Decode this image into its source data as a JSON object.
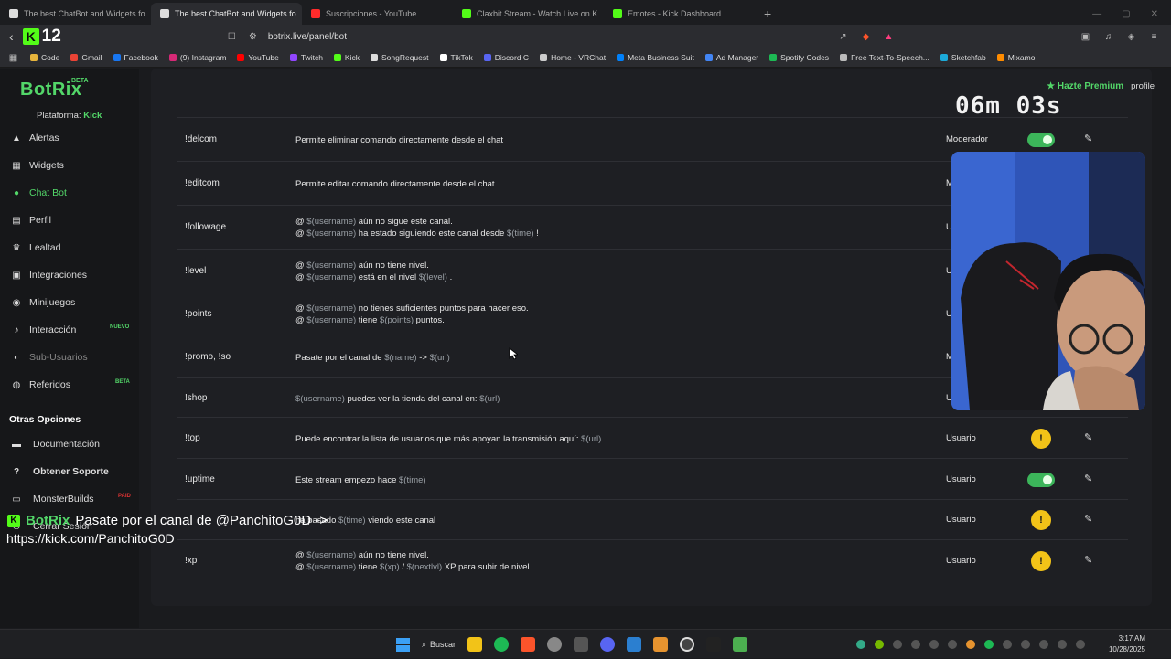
{
  "tabs": [
    {
      "title": "The best ChatBot and Widgets fo",
      "color": "#dddddd",
      "active": false
    },
    {
      "title": "The best ChatBot and Widgets fo",
      "color": "#dddddd",
      "active": true
    },
    {
      "title": "Suscripciones - YouTube",
      "color": "#ff2b2b",
      "active": false
    },
    {
      "title": "Claxbit Stream - Watch Live on K",
      "color": "#53fc18",
      "active": false
    },
    {
      "title": "Emotes - Kick Dashboard",
      "color": "#53fc18",
      "active": false
    }
  ],
  "address": {
    "url": "botrix.live/panel/bot",
    "overlay_number": "12"
  },
  "bookmarks": [
    {
      "label": "Code",
      "color": "#e7b43c"
    },
    {
      "label": "Gmail",
      "color": "#ea4335"
    },
    {
      "label": "Facebook",
      "color": "#1877f2"
    },
    {
      "label": "(9) Instagram",
      "color": "#d62976"
    },
    {
      "label": "YouTube",
      "color": "#ff0000"
    },
    {
      "label": "Twitch",
      "color": "#9146ff"
    },
    {
      "label": "Kick",
      "color": "#53fc18"
    },
    {
      "label": "SongRequest",
      "color": "#dddddd"
    },
    {
      "label": "TikTok",
      "color": "#ffffff"
    },
    {
      "label": "Discord C",
      "color": "#5865f2"
    },
    {
      "label": "Home - VRChat",
      "color": "#cccccc"
    },
    {
      "label": "Meta Business Suit",
      "color": "#0081fb"
    },
    {
      "label": "Ad Manager",
      "color": "#4285f4"
    },
    {
      "label": "Spotify Codes",
      "color": "#1db954"
    },
    {
      "label": "Free Text-To-Speech...",
      "color": "#bbbbbb"
    },
    {
      "label": "Sketchfab",
      "color": "#1caad9"
    },
    {
      "label": "Mixamo",
      "color": "#ff8c00"
    }
  ],
  "sidebar": {
    "brand": "BotRix",
    "brand_badge": "BETA",
    "platform_label": "Plataforma:",
    "platform_value": "Kick",
    "items": [
      {
        "label": "Alertas",
        "icon": "▲"
      },
      {
        "label": "Widgets",
        "icon": "▦"
      },
      {
        "label": "Chat Bot",
        "icon": "●"
      },
      {
        "label": "Perfil",
        "icon": "▤"
      },
      {
        "label": "Lealtad",
        "icon": "♛"
      },
      {
        "label": "Integraciones",
        "icon": "▣"
      },
      {
        "label": "Minijuegos",
        "icon": "◉"
      },
      {
        "label": "Interacción",
        "icon": "♪"
      },
      {
        "label": "Sub-Usuarios",
        "icon": "◐"
      },
      {
        "label": "Referidos",
        "icon": "◍"
      }
    ],
    "badge_nuevo": "NUEVO",
    "badge_beta": "BETA",
    "section_other": "Otras Opciones",
    "other": [
      {
        "label": "Documentación",
        "icon": "▬"
      },
      {
        "label": "Obtener Soporte",
        "icon": "?"
      },
      {
        "label": "MonsterBuilds",
        "icon": "▭"
      },
      {
        "label": "Cerrar Sesión",
        "icon": "⏻"
      }
    ],
    "badge_monster": "PAID"
  },
  "header": {
    "premium": "Hazte Premium",
    "profile": "profile"
  },
  "stream_timer": "06m 03s",
  "commands": [
    {
      "cmd": "!delcom",
      "lines": [
        [
          "t",
          "Permite eliminar comando directamente desde el chat"
        ]
      ],
      "perm": "Moderador",
      "status": "on"
    },
    {
      "cmd": "!editcom",
      "lines": [
        [
          "t",
          "Permite editar comando directamente desde el chat"
        ]
      ],
      "perm": "M",
      "status": ""
    },
    {
      "cmd": "!followage",
      "lines": [
        [
          "t",
          "@ "
        ],
        [
          "v",
          "$(username)"
        ],
        [
          "t",
          "  aún no sigue este canal."
        ],
        [
          "br",
          ""
        ],
        [
          "t",
          "@ "
        ],
        [
          "v",
          "$(username)"
        ],
        [
          "t",
          "  ha estado siguiendo este canal desde  "
        ],
        [
          "v",
          "$(time)"
        ],
        [
          "t",
          " !"
        ]
      ],
      "perm": "U",
      "status": ""
    },
    {
      "cmd": "!level",
      "lines": [
        [
          "t",
          "@ "
        ],
        [
          "v",
          "$(username)"
        ],
        [
          "t",
          "  aún no tiene nivel."
        ],
        [
          "br",
          ""
        ],
        [
          "t",
          "@ "
        ],
        [
          "v",
          "$(username)"
        ],
        [
          "t",
          "  está en el nivel  "
        ],
        [
          "v",
          "$(level)"
        ],
        [
          "t",
          "  ."
        ]
      ],
      "perm": "U",
      "status": ""
    },
    {
      "cmd": "!points",
      "lines": [
        [
          "t",
          "@ "
        ],
        [
          "v",
          "$(username)"
        ],
        [
          "t",
          "  no tienes suficientes puntos para hacer eso."
        ],
        [
          "br",
          ""
        ],
        [
          "t",
          "@ "
        ],
        [
          "v",
          "$(username)"
        ],
        [
          "t",
          "  tiene  "
        ],
        [
          "v",
          "$(points)"
        ],
        [
          "t",
          "  puntos."
        ]
      ],
      "perm": "U",
      "status": ""
    },
    {
      "cmd": "!promo, !so",
      "lines": [
        [
          "t",
          "Pasate por el canal de  "
        ],
        [
          "v",
          "$(name)"
        ],
        [
          "t",
          "  ->  "
        ],
        [
          "v",
          "$(url)"
        ]
      ],
      "perm": "M",
      "status": ""
    },
    {
      "cmd": "!shop",
      "lines": [
        [
          "t",
          " "
        ],
        [
          "v",
          "$(username)"
        ],
        [
          "t",
          "  puedes ver la tienda del canal en:  "
        ],
        [
          "v",
          "$(url)"
        ]
      ],
      "perm": "U",
      "status": ""
    },
    {
      "cmd": "!top",
      "lines": [
        [
          "t",
          "Puede encontrar la lista de usuarios que más apoyan la transmisión aquí:  "
        ],
        [
          "v",
          "$(url)"
        ]
      ],
      "perm": "Usuario",
      "status": "warn"
    },
    {
      "cmd": "!uptime",
      "lines": [
        [
          "t",
          "Este stream empezo hace  "
        ],
        [
          "v",
          "$(time)"
        ]
      ],
      "perm": "Usuario",
      "status": "on"
    },
    {
      "cmd": "",
      "lines": [
        [
          "t",
          "  ha pasado  "
        ],
        [
          "v",
          "$(time)"
        ],
        [
          "t",
          "  viendo este canal"
        ]
      ],
      "perm": "Usuario",
      "status": "warn"
    },
    {
      "cmd": "!xp",
      "lines": [
        [
          "t",
          "@ "
        ],
        [
          "v",
          "$(username)"
        ],
        [
          "t",
          "  aún no tiene nivel."
        ],
        [
          "br",
          ""
        ],
        [
          "t",
          "@ "
        ],
        [
          "v",
          "$(username)"
        ],
        [
          "t",
          "  tiene  "
        ],
        [
          "v",
          "$(xp)"
        ],
        [
          "t",
          " / "
        ],
        [
          "v",
          "$(nextlvl)"
        ],
        [
          "t",
          " XP para subir de nivel."
        ]
      ],
      "perm": "Usuario",
      "status": "warn"
    }
  ],
  "chat_overlay": {
    "brand": "BotRix",
    "line1": "Pasate por el canal de @PanchitoG0D ->",
    "line2": "https://kick.com/PanchitoG0D"
  },
  "taskbar": {
    "search": "Buscar",
    "time": "3:17 AM",
    "date": "10/28/2025"
  }
}
